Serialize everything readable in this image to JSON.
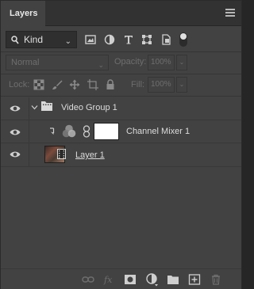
{
  "panel": {
    "tab_title": "Layers"
  },
  "filter": {
    "kind_label": "Kind",
    "icons": [
      "pixel-layer-filter-icon",
      "adjustment-layer-filter-icon",
      "type-layer-filter-icon",
      "shape-layer-filter-icon",
      "smart-object-filter-icon",
      "filter-toggle-icon"
    ]
  },
  "blend": {
    "mode": "Normal",
    "opacity_label": "Opacity:",
    "opacity_value": "100%"
  },
  "lock": {
    "label": "Lock:",
    "icons": [
      "lock-transparent-pixels-icon",
      "lock-image-pixels-icon",
      "lock-position-icon",
      "lock-artboard-icon",
      "lock-all-icon"
    ],
    "fill_label": "Fill:",
    "fill_value": "100%"
  },
  "layers": [
    {
      "name": "Video Group 1",
      "type": "group",
      "visible": true
    },
    {
      "name": "Channel Mixer 1",
      "type": "adjustment",
      "visible": true
    },
    {
      "name": "Layer 1",
      "type": "video",
      "visible": true
    }
  ],
  "bottom_toolbar": [
    "link-layers-icon",
    "fx-icon",
    "add-mask-icon",
    "new-adjustment-layer-icon",
    "new-group-icon",
    "new-layer-icon",
    "delete-layer-icon"
  ]
}
